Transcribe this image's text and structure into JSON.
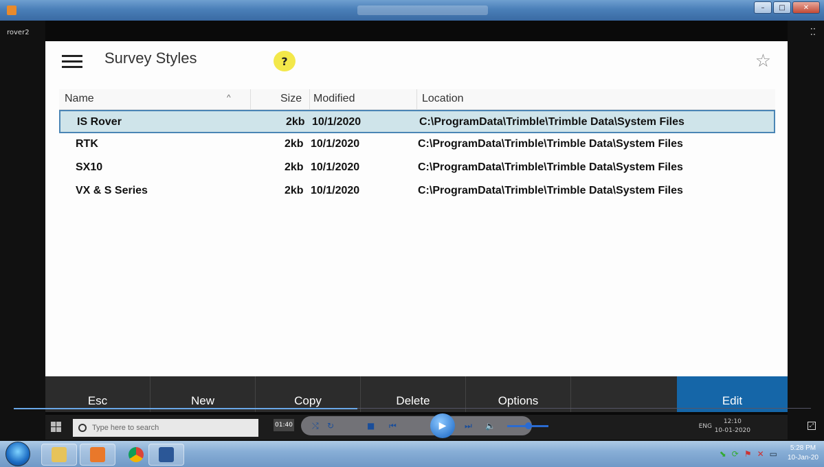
{
  "session": {
    "label": "rover2"
  },
  "panel": {
    "title": "Survey Styles"
  },
  "table": {
    "columns": {
      "name": "Name",
      "size": "Size",
      "modified": "Modified",
      "location": "Location"
    },
    "rows": [
      {
        "name": "IS Rover",
        "size": "2kb",
        "modified": "10/1/2020",
        "location": "C:\\ProgramData\\Trimble\\Trimble Data\\System Files",
        "selected": true
      },
      {
        "name": "RTK",
        "size": "2kb",
        "modified": "10/1/2020",
        "location": "C:\\ProgramData\\Trimble\\Trimble Data\\System Files"
      },
      {
        "name": "SX10",
        "size": "2kb",
        "modified": "10/1/2020",
        "location": "C:\\ProgramData\\Trimble\\Trimble Data\\System Files"
      },
      {
        "name": "VX & S Series",
        "size": "2kb",
        "modified": "10/1/2020",
        "location": "C:\\ProgramData\\Trimble\\Trimble Data\\System Files"
      }
    ]
  },
  "toolbar": {
    "esc": "Esc",
    "new": "New",
    "copy": "Copy",
    "delete": "Delete",
    "options": "Options",
    "edit": "Edit"
  },
  "inner_taskbar": {
    "search_placeholder": "Type here to search",
    "lang": "ENG",
    "time": "12:10",
    "date": "10-01-2020"
  },
  "media": {
    "elapsed": "01:40"
  },
  "host_clock": {
    "time": "5:28 PM",
    "date": "10-Jan-20"
  },
  "colors": {
    "accent": "#1566a8",
    "selected_row": "#cfe4ea",
    "toolbar": "#2c2c2c"
  }
}
